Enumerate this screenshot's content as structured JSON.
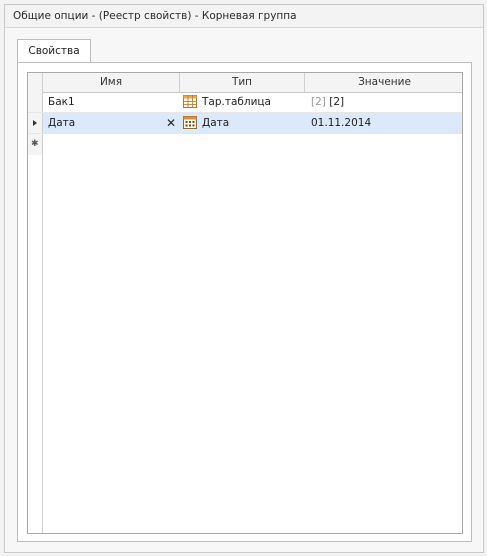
{
  "window": {
    "title": "Общие опции - (Реестр свойств) - Корневая группа"
  },
  "tabs": [
    {
      "label": "Свойства"
    }
  ],
  "grid": {
    "columns": [
      "Имя",
      "Тип",
      "Значение"
    ],
    "rows": [
      {
        "name": "Бак1",
        "type_icon": "table-icon",
        "type": "Тар.таблица",
        "value_count": "[2]",
        "value": "[2]"
      },
      {
        "name": "Дата",
        "type_icon": "calendar-icon",
        "type": "Дата",
        "value": "01.11.2014",
        "delete_glyph": "✕"
      }
    ],
    "new_row_glyph": "✱"
  }
}
